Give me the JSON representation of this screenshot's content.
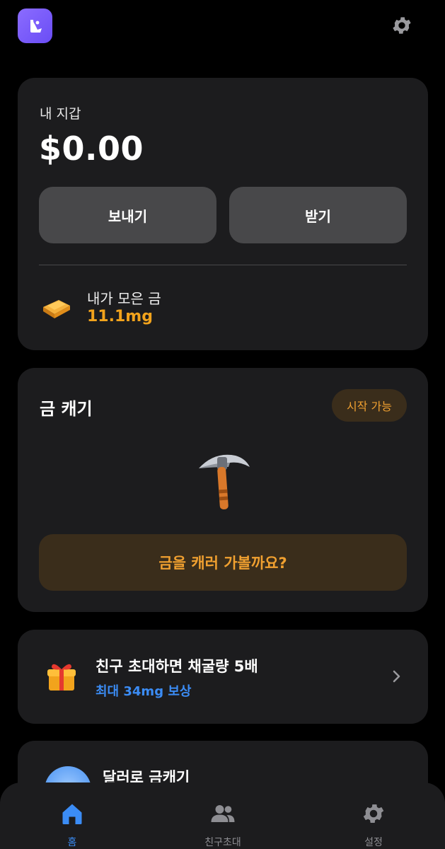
{
  "header": {
    "logo_icon": "app-logo-icon",
    "settings_icon": "gear-icon"
  },
  "wallet": {
    "title": "내 지갑",
    "amount": "$0.00",
    "send_label": "보내기",
    "receive_label": "받기",
    "gold_label": "내가 모은 금",
    "gold_value": "11.1mg",
    "gold_icon": "gold-bar-icon"
  },
  "mining": {
    "title": "금 캐기",
    "status": "시작 가능",
    "pickaxe_icon": "pickaxe-icon",
    "cta_label": "금을 캐러 가볼까요?"
  },
  "invite": {
    "title": "친구 초대하면 채굴량 5배",
    "subtitle": "최대 34mg 보상",
    "icon": "gift-icon"
  },
  "dollar_mining": {
    "title": "달러로 금캐기"
  },
  "nav": {
    "items": [
      {
        "label": "홈",
        "icon": "home-icon"
      },
      {
        "label": "친구초대",
        "icon": "users-icon"
      },
      {
        "label": "설정",
        "icon": "gear-icon"
      }
    ]
  },
  "colors": {
    "background": "#000000",
    "card": "#1c1c1e",
    "button_grey": "#48484a",
    "gold": "#f2a31c",
    "accent_blue": "#3b8cf5",
    "cta_bg": "#3a2d1b",
    "cta_text": "#f0a030",
    "logo": "#7b5cff"
  }
}
